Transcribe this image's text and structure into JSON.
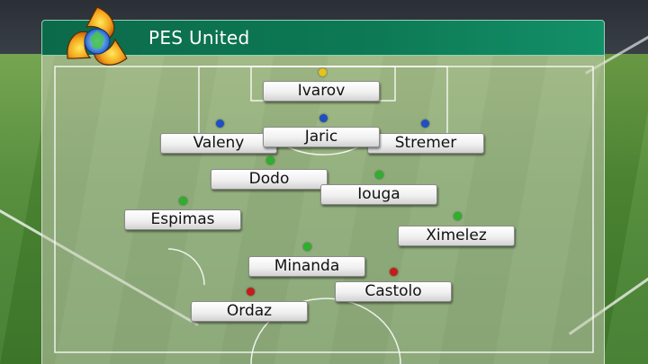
{
  "team": {
    "name": "PES United"
  },
  "colors": {
    "gk": "#e8c21a",
    "defender": "#1f4fc4",
    "midfielder": "#2bb12b",
    "forward": "#c81a1a",
    "header": "#0d7a55"
  },
  "icons": {
    "logo": "tri-swirl-emblem"
  },
  "players": [
    {
      "name": "Ivarov",
      "role": "goalkeeper"
    },
    {
      "name": "Valeny",
      "role": "defender"
    },
    {
      "name": "Jaric",
      "role": "defender"
    },
    {
      "name": "Stremer",
      "role": "defender"
    },
    {
      "name": "Dodo",
      "role": "midfielder"
    },
    {
      "name": "Iouga",
      "role": "midfielder"
    },
    {
      "name": "Espimas",
      "role": "midfielder"
    },
    {
      "name": "Ximelez",
      "role": "midfielder"
    },
    {
      "name": "Minanda",
      "role": "midfielder"
    },
    {
      "name": "Castolo",
      "role": "forward"
    },
    {
      "name": "Ordaz",
      "role": "forward"
    }
  ]
}
